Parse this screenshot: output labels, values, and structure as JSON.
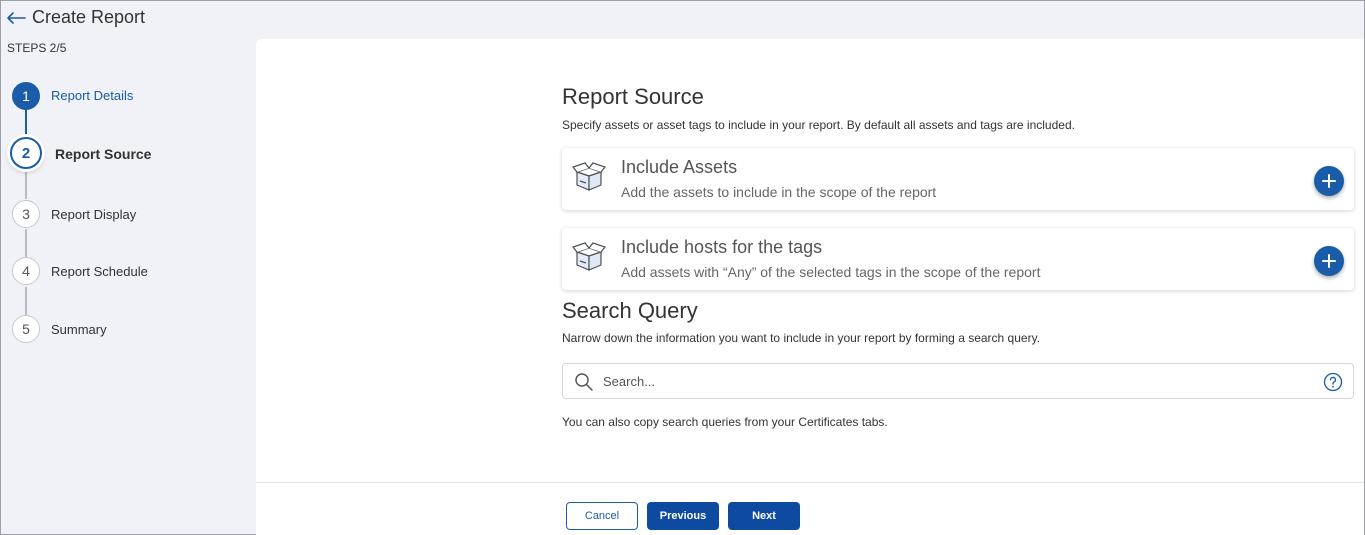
{
  "header": {
    "title": "Create Report",
    "steps_counter": "STEPS 2/5"
  },
  "stepper": {
    "steps": [
      {
        "number": "1",
        "label": "Report Details",
        "state": "done"
      },
      {
        "number": "2",
        "label": "Report Source",
        "state": "active"
      },
      {
        "number": "3",
        "label": "Report Display",
        "state": "pending"
      },
      {
        "number": "4",
        "label": "Report Schedule",
        "state": "pending"
      },
      {
        "number": "5",
        "label": "Summary",
        "state": "pending"
      }
    ]
  },
  "report_source": {
    "title": "Report Source",
    "description": "Specify assets or asset tags to include in your report. By default all assets and tags are included.",
    "cards": [
      {
        "title": "Include Assets",
        "description": "Add the assets to include in the scope of the report",
        "icon": "box-icon"
      },
      {
        "title": "Include hosts for the tags",
        "description": "Add assets with “Any” of the selected tags in the scope of the report",
        "icon": "box-icon"
      }
    ]
  },
  "search_query": {
    "title": "Search Query",
    "description": "Narrow down the information you want to include in your report by forming a search query.",
    "placeholder": "Search...",
    "value": "",
    "note": "You can also copy search queries from your Certificates tabs."
  },
  "footer": {
    "cancel_label": "Cancel",
    "previous_label": "Previous",
    "next_label": "Next"
  },
  "colors": {
    "accent": "#1a5ca8",
    "primary_button": "#0d4aa0",
    "sidebar_bg": "#f0f2f8",
    "panel_bg": "#ffffff"
  }
}
